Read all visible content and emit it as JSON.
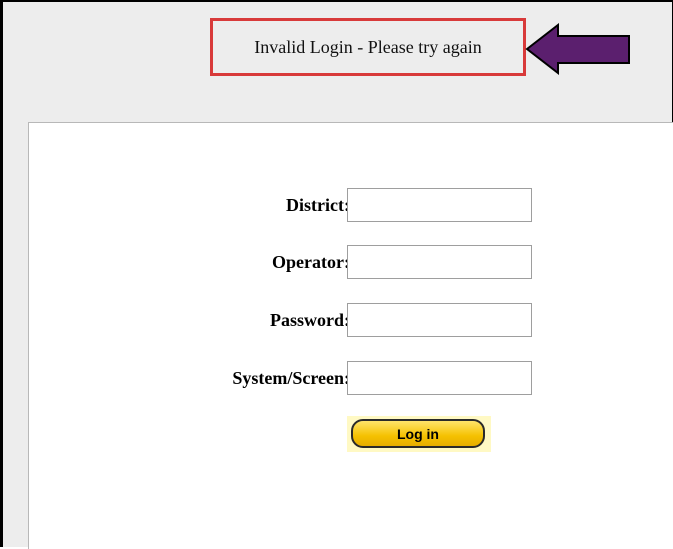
{
  "error": {
    "message": "Invalid Login - Please try again"
  },
  "colors": {
    "highlight_border": "#d83a3a",
    "arrow": "#5b1f6e",
    "button": "#f5c100"
  },
  "icons": {
    "pointer": "left-arrow-icon"
  },
  "form": {
    "district": {
      "label": "District:",
      "value": ""
    },
    "operator": {
      "label": "Operator:",
      "value": ""
    },
    "password": {
      "label": "Password:",
      "value": ""
    },
    "system_screen": {
      "label": "System/Screen:",
      "value": ""
    },
    "login_label": "Log in"
  }
}
